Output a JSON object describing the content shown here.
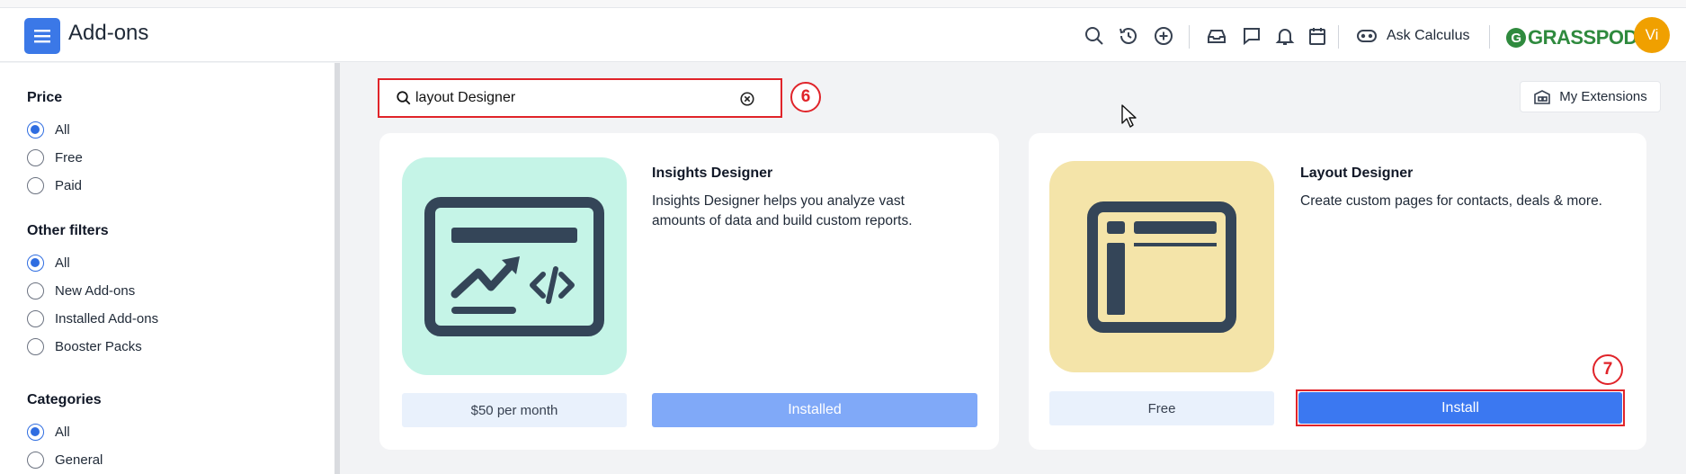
{
  "header": {
    "title": "Add-ons",
    "ask_label": "Ask Calculus",
    "brand": "GRASSPODS",
    "brand_initial": "G",
    "avatar_initials": "Vi",
    "icons": [
      "menu-icon",
      "search-icon",
      "history-icon",
      "add-circle-icon",
      "inbox-icon",
      "chat-icon",
      "bell-icon",
      "calendar-icon",
      "gamepad-icon"
    ]
  },
  "sidebar": {
    "price": {
      "title": "Price",
      "options": [
        "All",
        "Free",
        "Paid"
      ],
      "selected": "All"
    },
    "other": {
      "title": "Other filters",
      "options": [
        "All",
        "New Add-ons",
        "Installed Add-ons",
        "Booster Packs"
      ],
      "selected": "All"
    },
    "categories": {
      "title": "Categories",
      "options": [
        "All",
        "General"
      ],
      "selected": "All"
    }
  },
  "search": {
    "value": "layout Designer",
    "step": "6"
  },
  "extensions_label": "My Extensions",
  "cards": [
    {
      "title": "Insights Designer",
      "desc": "Insights Designer helps you analyze vast amounts of data and build custom reports.",
      "price": "$50 per month",
      "action": "Installed",
      "tile_color": "#c5f4e7"
    },
    {
      "title": "Layout Designer",
      "desc": "Create custom pages for contacts, deals & more.",
      "price": "Free",
      "action": "Install",
      "step": "7",
      "tile_color": "#f4e4a9"
    }
  ],
  "colors": {
    "accent": "#3b78e7",
    "highlight": "#e0242a",
    "icon_dark": "#344558"
  }
}
